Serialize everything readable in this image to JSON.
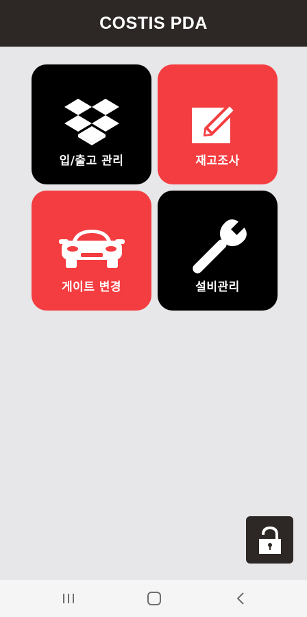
{
  "app_bar": {
    "title": "COSTIS PDA"
  },
  "menu": {
    "tiles": [
      {
        "label": "입/출고 관리",
        "icon": "dropbox-icon",
        "color": "#000000"
      },
      {
        "label": "재고조사",
        "icon": "pencil-square-icon",
        "color": "#f43d40"
      },
      {
        "label": "게이트 변경",
        "icon": "car-icon",
        "color": "#f43d40"
      },
      {
        "label": "설비관리",
        "icon": "wrench-icon",
        "color": "#000000"
      }
    ]
  },
  "lock_button": {
    "icon": "unlock-icon"
  },
  "nav_bar": {
    "icons": [
      "recent-apps-icon",
      "home-icon",
      "back-icon"
    ]
  },
  "colors": {
    "header": "#2d2825",
    "accent_red": "#f43d40",
    "background": "#e7e7e9"
  }
}
